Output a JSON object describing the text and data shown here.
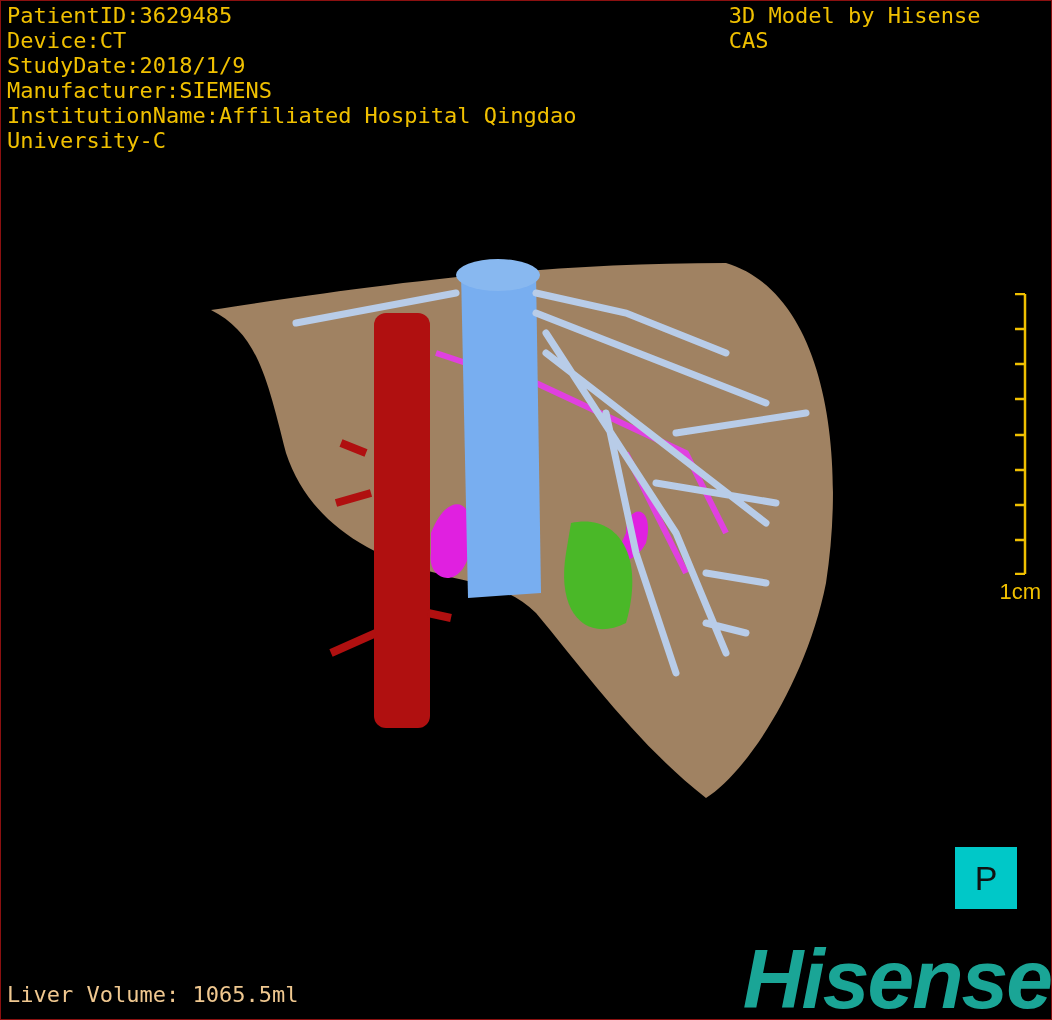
{
  "info_lines": [
    "PatientID:3629485",
    "Device:CT",
    "StudyDate:2018/1/9",
    "Manufacturer:SIEMENS",
    "InstitutionName:Affiliated Hospital Qingdao University-C"
  ],
  "title": "3D Model by Hisense CAS",
  "scale_label": "1cm",
  "view_button": "P",
  "liver_volume": "Liver Volume: 1065.5ml",
  "logo": "Hisense"
}
